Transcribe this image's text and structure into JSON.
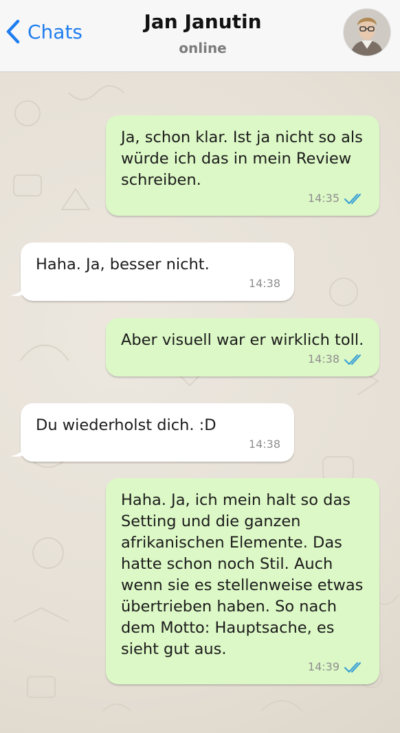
{
  "header": {
    "back_label": "Chats",
    "title": "Jan Janutin",
    "status": "online"
  },
  "colors": {
    "accent": "#1e7df0",
    "outgoing_bubble": "#dcf8c6",
    "incoming_bubble": "#ffffff",
    "read_ticks": "#3aa0d6"
  },
  "messages": [
    {
      "direction": "out",
      "text": "Ja, schon klar. Ist ja nicht so als\nwürde ich das in mein Review\nschreiben.",
      "time": "14:35",
      "status": "read"
    },
    {
      "direction": "in",
      "text": "Haha. Ja, besser nicht.",
      "time": "14:38"
    },
    {
      "direction": "out",
      "text": "Aber visuell war er wirklich toll.",
      "time": "14:38",
      "status": "read"
    },
    {
      "direction": "in",
      "text": "Du wiederholst dich. :D",
      "time": "14:38"
    },
    {
      "direction": "out",
      "text": "Haha. Ja, ich mein halt so das\nSetting und die ganzen\nafrikanischen Elemente. Das\nhatte schon noch Stil. Auch\nwenn sie es stellenweise etwas\nübertrieben haben. So nach\ndem Motto: Hauptsache, es\nsieht gut aus.",
      "time": "14:39",
      "status": "read"
    }
  ]
}
